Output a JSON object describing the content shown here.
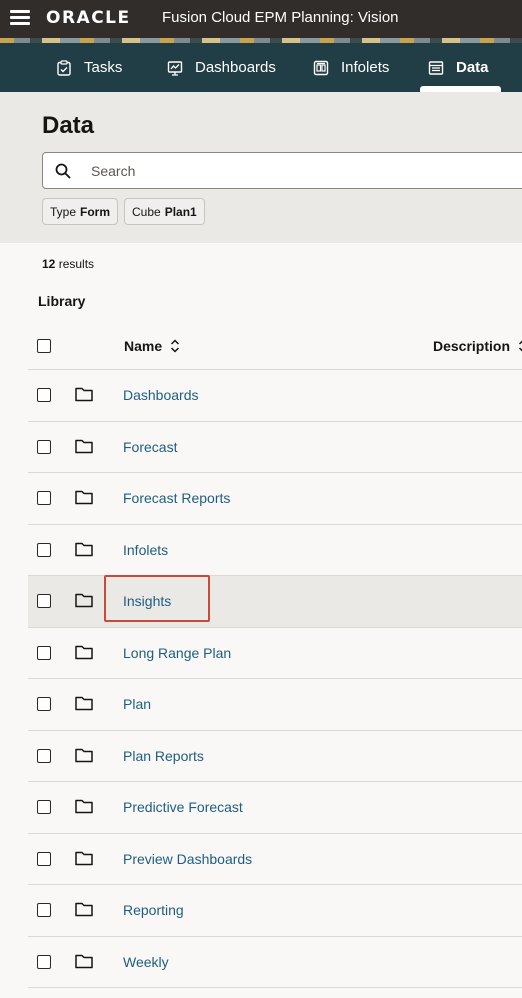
{
  "topbar": {
    "logo": "ORACLE",
    "app_title": "Fusion Cloud EPM Planning: Vision"
  },
  "nav": {
    "items": [
      {
        "label": "Tasks",
        "icon": "tasks-icon"
      },
      {
        "label": "Dashboards",
        "icon": "dashboards-icon"
      },
      {
        "label": "Infolets",
        "icon": "infolets-icon"
      },
      {
        "label": "Data",
        "icon": "data-icon",
        "active": true
      }
    ]
  },
  "page": {
    "title": "Data"
  },
  "search": {
    "placeholder": "Search",
    "value": ""
  },
  "filters": [
    {
      "key": "Type",
      "value": "Form"
    },
    {
      "key": "Cube",
      "value": "Plan1"
    }
  ],
  "results": {
    "count": "12",
    "label": "results"
  },
  "library": {
    "label": "Library"
  },
  "table": {
    "columns": {
      "name": "Name",
      "description": "Description"
    },
    "rows": [
      {
        "name": "Dashboards"
      },
      {
        "name": "Forecast"
      },
      {
        "name": "Forecast Reports"
      },
      {
        "name": "Infolets"
      },
      {
        "name": "Insights",
        "selected": true
      },
      {
        "name": "Long Range Plan"
      },
      {
        "name": "Plan"
      },
      {
        "name": "Plan Reports"
      },
      {
        "name": "Predictive Forecast"
      },
      {
        "name": "Preview Dashboards"
      },
      {
        "name": "Reporting"
      },
      {
        "name": "Weekly"
      }
    ]
  },
  "colors": {
    "topbar_bg": "#312d2a",
    "navbar_bg": "#213d46",
    "link": "#1f5e80",
    "highlight": "#c94a3b"
  }
}
